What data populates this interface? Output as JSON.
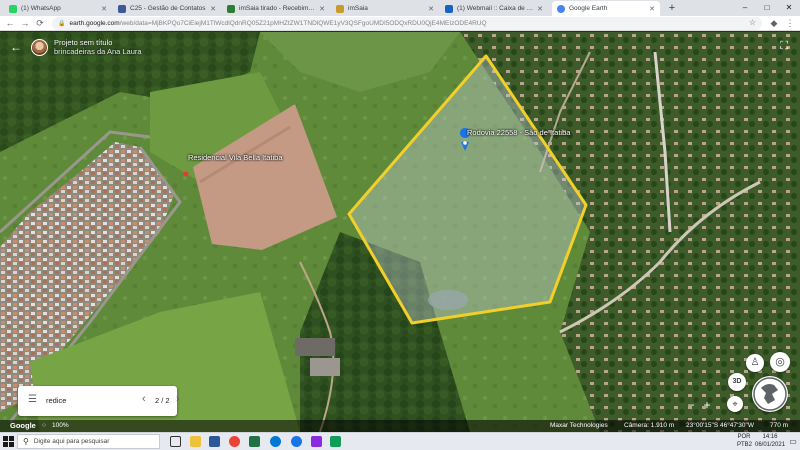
{
  "browser": {
    "tabs": [
      {
        "label": "(1) WhatsApp",
        "favicon_color": "#25d366"
      },
      {
        "label": "C25 - Gestão de Contatos",
        "favicon_color": "#3b5998"
      },
      {
        "label": "imSaia tirado - Recebimento A",
        "favicon_color": "#2e7d32"
      },
      {
        "label": "imSaia",
        "favicon_color": "#c79a2b"
      },
      {
        "label": "(1) Webmail :: Caixa de entrada",
        "favicon_color": "#1565c0"
      },
      {
        "label": "Google Earth",
        "favicon_color": "#4285f4"
      }
    ],
    "active_tab": 5,
    "address": {
      "host": "earth.google.com",
      "path": "/web/data=MjBKPQo7CiEiejM1TlWcdlQdnRQ05Z21pMHZtZW1TNDlQWE1yV3QSFgoUMDI5ODQxRDU0QjE4MEIzODE4RUQ"
    }
  },
  "project": {
    "title": "Projeto sem título",
    "subtitle": "brincadeiras da Ana Laura"
  },
  "labels": {
    "residencial": "Residencial Vila Bella Itatiba",
    "placemark": "Rodovia 22558 - São de Itatiba"
  },
  "search": {
    "query": "redice",
    "result_position": "2 / 2"
  },
  "status": {
    "attribution": "Maxar Technologies",
    "camera": "Câmera: 1.910 m",
    "coords": "23°00'15\"S 46°47'30\"W",
    "elevation": "770 m",
    "zoom_percent": "100%"
  },
  "controls": {
    "mode_3d": "3D"
  },
  "taskbar": {
    "search_placeholder": "Digite aqui para pesquisar",
    "language": "POR",
    "keyboard": "PTB2",
    "time": "14:16",
    "date": "06/01/2021"
  },
  "colors": {
    "polygon_stroke": "#f2cf2b",
    "polygon_fill": "#c8d3dd",
    "placemark": "#1a73e8"
  },
  "icons": [
    "back-arrow-icon",
    "fullscreen-icon",
    "list-icon",
    "chevron-left-icon",
    "chevron-right-icon",
    "compass-icon",
    "location-icon",
    "pegman-icon",
    "globe-icon",
    "search-icon",
    "windows-icon"
  ]
}
